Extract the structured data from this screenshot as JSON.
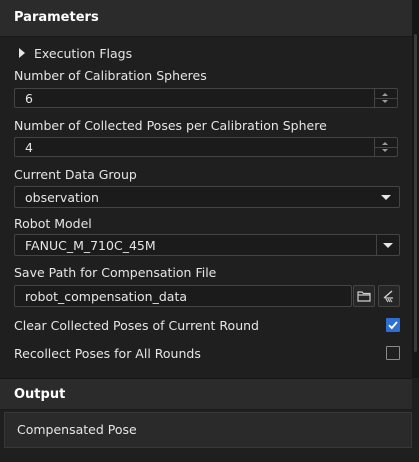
{
  "parameters": {
    "title": "Parameters",
    "execution_flags": "Execution Flags",
    "num_spheres_label": "Number of Calibration Spheres",
    "num_spheres_value": "6",
    "num_poses_label": "Number of Collected Poses per Calibration Sphere",
    "num_poses_value": "4",
    "data_group_label": "Current Data Group",
    "data_group_value": "observation",
    "robot_model_label": "Robot Model",
    "robot_model_value": "FANUC_M_710C_45M",
    "save_path_label": "Save Path for Compensation File",
    "save_path_value": "robot_compensation_data",
    "clear_poses_label": "Clear Collected Poses of Current Round",
    "clear_poses_checked": true,
    "recollect_label": "Recollect Poses for All Rounds",
    "recollect_checked": false
  },
  "output": {
    "title": "Output",
    "item": "Compensated Pose"
  },
  "colors": {
    "accent": "#2f6fd1",
    "background": "#1f1f1f",
    "header": "#2b2b2b"
  }
}
